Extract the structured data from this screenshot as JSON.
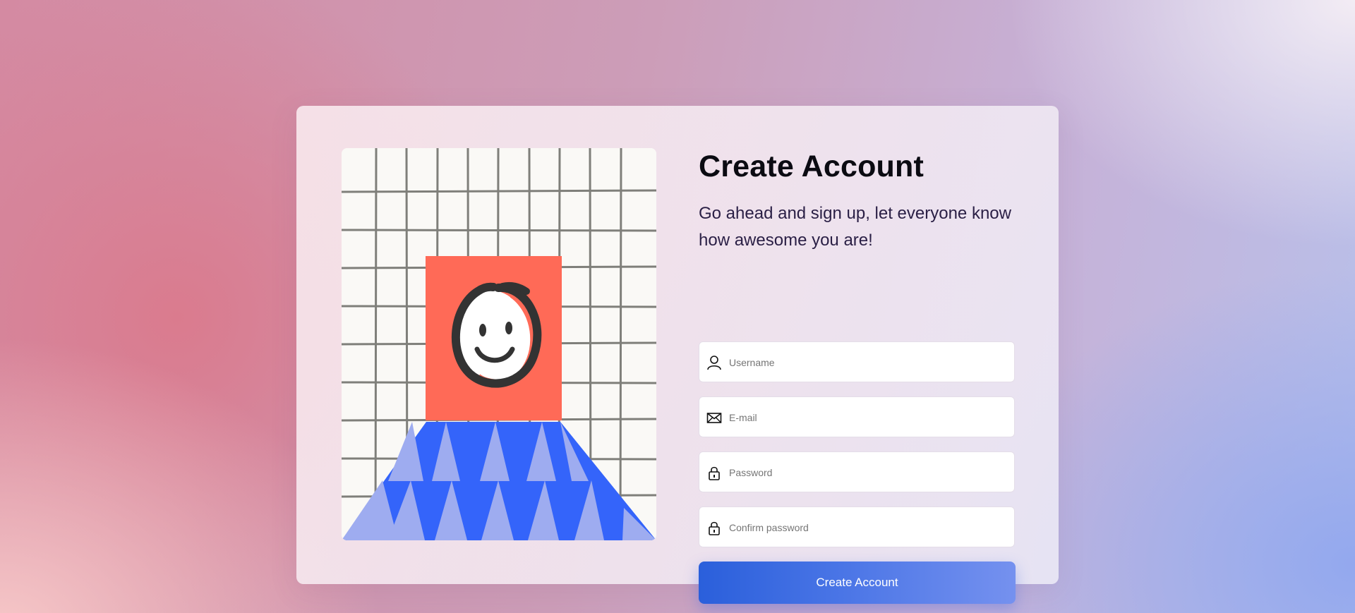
{
  "form": {
    "title": "Create Account",
    "subtitle": "Go ahead and sign up, let everyone know how awesome you are!",
    "fields": [
      {
        "icon": "user-icon",
        "placeholder": "Username",
        "value": ""
      },
      {
        "icon": "mail-icon",
        "placeholder": "E-mail",
        "value": ""
      },
      {
        "icon": "lock-icon",
        "placeholder": "Password",
        "value": ""
      },
      {
        "icon": "lock-icon",
        "placeholder": "Confirm password",
        "value": ""
      }
    ],
    "submit_label": "Create Account"
  },
  "colors": {
    "accent": "#2a5fdb",
    "accent_end": "#7591ef",
    "illustration_orange": "#ff6a57",
    "illustration_blue": "#3464fa",
    "illustration_light_blue": "#9eacf0"
  }
}
